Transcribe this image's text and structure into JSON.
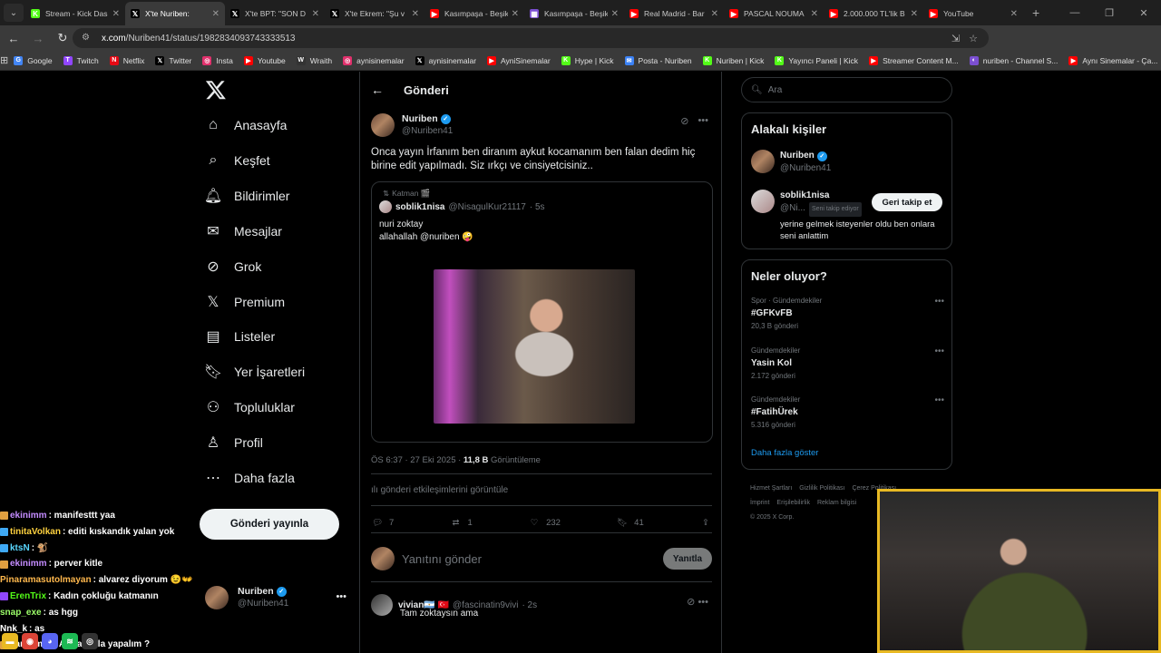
{
  "browser": {
    "tabs": [
      {
        "label": "Stream - Kick Das",
        "color": "#53fc18",
        "glyph": "K",
        "active": false
      },
      {
        "label": "X'te Nuriben:",
        "color": "#000000",
        "glyph": "𝕏",
        "active": true
      },
      {
        "label": "X'te BPT: \"SON D",
        "color": "#000000",
        "glyph": "𝕏",
        "active": false
      },
      {
        "label": "X'te Ekrem: \"Şu v",
        "color": "#000000",
        "glyph": "𝕏",
        "active": false
      },
      {
        "label": "Kasımpaşa - Beşik",
        "color": "#ff0000",
        "glyph": "▶",
        "active": false
      },
      {
        "label": "Kasımpaşa - Beşik",
        "color": "#7b4fd1",
        "glyph": "▦",
        "active": false
      },
      {
        "label": "Real Madrid - Bar",
        "color": "#ff0000",
        "glyph": "▶",
        "active": false
      },
      {
        "label": "PASCAL NOUMA",
        "color": "#ff0000",
        "glyph": "▶",
        "active": false
      },
      {
        "label": "2.000.000 TL'lik B",
        "color": "#ff0000",
        "glyph": "▶",
        "active": false
      },
      {
        "label": "YouTube",
        "color": "#ff0000",
        "glyph": "▶",
        "active": false
      }
    ],
    "url_domain": "x.com",
    "url_path": "/Nuriben41/status/1982834093743333513",
    "bookmarks": [
      {
        "label": "Google",
        "color": "#4285f4",
        "glyph": "G"
      },
      {
        "label": "Twitch",
        "color": "#9146ff",
        "glyph": "T"
      },
      {
        "label": "Netflix",
        "color": "#e50914",
        "glyph": "N"
      },
      {
        "label": "Twitter",
        "color": "#000000",
        "glyph": "𝕏"
      },
      {
        "label": "Insta",
        "color": "#e1306c",
        "glyph": "◎"
      },
      {
        "label": "Youtube",
        "color": "#ff0000",
        "glyph": "▶"
      },
      {
        "label": "Wraith",
        "color": "#333333",
        "glyph": "W"
      },
      {
        "label": "aynisinemalar",
        "color": "#e1306c",
        "glyph": "◎"
      },
      {
        "label": "aynisinemalar",
        "color": "#000000",
        "glyph": "𝕏"
      },
      {
        "label": "AyniSinemalar",
        "color": "#ff0000",
        "glyph": "▶"
      },
      {
        "label": "Hype | Kick",
        "color": "#53fc18",
        "glyph": "K"
      },
      {
        "label": "Posta - Nuriben",
        "color": "#3b82f6",
        "glyph": "✉"
      },
      {
        "label": "Nuriben | Kick",
        "color": "#53fc18",
        "glyph": "K"
      },
      {
        "label": "Yayıncı Paneli | Kick",
        "color": "#53fc18",
        "glyph": "K"
      },
      {
        "label": "Streamer Content M...",
        "color": "#ff0000",
        "glyph": "▶"
      },
      {
        "label": "nuriben - Channel S...",
        "color": "#7b4fd1",
        "glyph": "◐"
      },
      {
        "label": "Aynı Sinemalar - Ça...",
        "color": "#ff0000",
        "glyph": "▶"
      }
    ]
  },
  "sidebar": {
    "items": [
      {
        "label": "Anasayfa",
        "icon": "home-icon"
      },
      {
        "label": "Keşfet",
        "icon": "search-icon"
      },
      {
        "label": "Bildirimler",
        "icon": "bell-icon"
      },
      {
        "label": "Mesajlar",
        "icon": "mail-icon"
      },
      {
        "label": "Grok",
        "icon": "grok-icon"
      },
      {
        "label": "Premium",
        "icon": "x-icon"
      },
      {
        "label": "Listeler",
        "icon": "list-icon"
      },
      {
        "label": "Yer İşaretleri",
        "icon": "bookmark-icon"
      },
      {
        "label": "Topluluklar",
        "icon": "people-icon"
      },
      {
        "label": "Profil",
        "icon": "person-icon"
      },
      {
        "label": "Daha fazla",
        "icon": "more-circle-icon"
      }
    ],
    "post_button": "Gönderi yayınla",
    "account": {
      "name": "Nuriben",
      "handle": "@Nuriben41"
    }
  },
  "main": {
    "title": "Gönderi",
    "tweet": {
      "name": "Nuriben",
      "handle": "@Nuriben41",
      "text": "Onca yayın İrfanım ben diranım aykut kocamanım ben falan dedim hiç birine edit yapılmadı. Siz ırkçı ve cinsiyetcisiniz..",
      "quote": {
        "repost_label": "Katman 🎬",
        "name": "soblik1nisa",
        "handle": "@NisagulKur21117",
        "time": "· 5s",
        "line1": "nuri zoktay",
        "line2": "allahallah @nuriben 🤪"
      },
      "time": "ÖS 6:37 · 27 Eki 2025 ·",
      "views": "11,8 B",
      "views_label": "Görüntüleme",
      "analytics": "gönderi etkileşimlerini görüntüle",
      "replies": "7",
      "reposts": "1",
      "likes": "232",
      "bookmarks": "41"
    },
    "reply_placeholder": "Yanıtını gönder",
    "reply_button": "Yanıtla",
    "first_reply": {
      "name": "vivian🇦🇷 🇹🇷",
      "handle": "@fascinatin9vivi",
      "time": "· 2s",
      "text": "Tam zoktaysın ama"
    }
  },
  "right": {
    "search_placeholder": "Ara",
    "related_title": "Alakalı kişiler",
    "related": [
      {
        "name": "Nuriben",
        "handle": "@Nuriben41",
        "verified": true
      },
      {
        "name": "soblik1nisa",
        "handle": "@Ni...",
        "follows_you": "Seni takip ediyor",
        "follow_button": "Geri takip et",
        "bio": "yerine gelmek isteyenler oldu ben onlara seni anlattim"
      }
    ],
    "trends_title": "Neler oluyor?",
    "trends": [
      {
        "category": "Spor · Gündemdekiler",
        "name": "#GFKvFB",
        "posts": "20,3 B gönderi"
      },
      {
        "category": "Gündemdekiler",
        "name": "Yasin Kol",
        "posts": "2.172 gönderi"
      },
      {
        "category": "Gündemdekiler",
        "name": "#FatihÜrek",
        "posts": "5.316 gönderi"
      }
    ],
    "show_more": "Daha fazla göster",
    "footer": [
      "Hizmet Şartları",
      "Gizlilik Politikası",
      "Çerez Politikası",
      "İmprint",
      "Erişilebilirlik",
      "Reklam bilgisi",
      "© 2025 X Corp."
    ]
  },
  "chat": [
    {
      "user": "ekinimm",
      "msg": ": manifesttt yaa",
      "color": "#c48cff",
      "badge": "#e0a040"
    },
    {
      "user": "tinitaVolkan",
      "msg": ": editi kıskandık yalan yok",
      "color": "#ffd23f",
      "badge": "#3fa9f5"
    },
    {
      "user": "ktsN",
      "msg": ": 🐒",
      "color": "#59d7ff",
      "badge": "#3fa9f5"
    },
    {
      "user": "ekinimm",
      "msg": ": perver kitle",
      "color": "#c48cff",
      "badge": "#e0a040"
    },
    {
      "user": "Pinaramasutolmayan",
      "msg": ": alvarez diyorum 😉👐",
      "color": "#ffb84d",
      "badge": ""
    },
    {
      "user": "ErenTrix",
      "msg": ": Kadın çokluğu katmanın",
      "color": "#53fc18",
      "badge": "#9146ff"
    },
    {
      "user": "snap_exe",
      "msg": ": as hgg",
      "color": "#9dff6a",
      "badge": ""
    },
    {
      "user": "Nnk_k",
      "msg": ": as",
      "color": "#ffffff",
      "badge": ""
    },
    {
      "user": "candrmzz",
      "msg": ": Amrabat'la yapalım ?",
      "color": "#ffffff",
      "badge": "#e0a040"
    }
  ]
}
